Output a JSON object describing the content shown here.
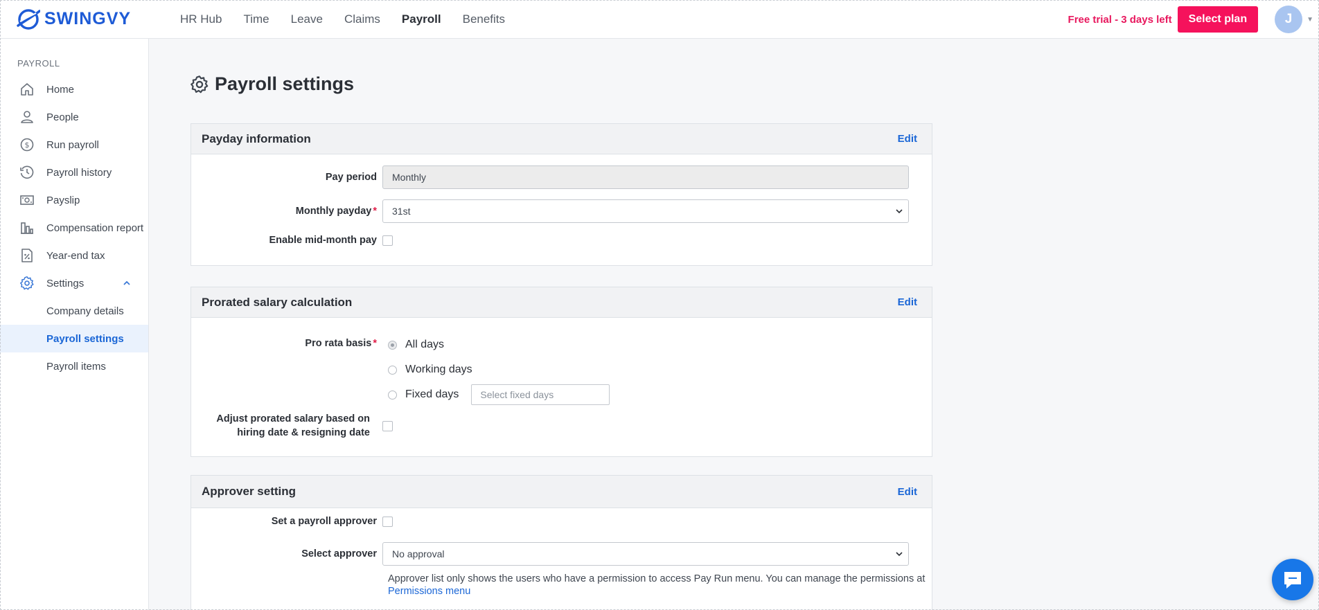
{
  "app": {
    "logo_text": "SWINGVY"
  },
  "nav": [
    {
      "label": "HR Hub",
      "active": false
    },
    {
      "label": "Time",
      "active": false
    },
    {
      "label": "Leave",
      "active": false
    },
    {
      "label": "Claims",
      "active": false
    },
    {
      "label": "Payroll",
      "active": true
    },
    {
      "label": "Benefits",
      "active": false
    }
  ],
  "header": {
    "trial_text": "Free trial - 3 days left",
    "plan_button": "Select plan",
    "avatar_initial": "J"
  },
  "sidebar": {
    "section": "PAYROLL",
    "items": [
      {
        "label": "Home",
        "icon": "home-icon"
      },
      {
        "label": "People",
        "icon": "person-icon"
      },
      {
        "label": "Run payroll",
        "icon": "dollar-circle-icon"
      },
      {
        "label": "Payroll history",
        "icon": "history-icon"
      },
      {
        "label": "Payslip",
        "icon": "money-bill-icon"
      },
      {
        "label": "Compensation report",
        "icon": "bar-chart-icon"
      },
      {
        "label": "Year-end tax",
        "icon": "percent-doc-icon"
      },
      {
        "label": "Settings",
        "icon": "gear-icon"
      }
    ],
    "sub_items": [
      {
        "label": "Company details",
        "active": false
      },
      {
        "label": "Payroll settings",
        "active": true
      },
      {
        "label": "Payroll items",
        "active": false
      }
    ]
  },
  "page": {
    "title": "Payroll settings"
  },
  "payday": {
    "title": "Payday information",
    "edit": "Edit",
    "pay_period_label": "Pay period",
    "pay_period_value": "Monthly",
    "monthly_payday_label": "Monthly payday",
    "monthly_payday_value": "31st",
    "mid_month_label": "Enable mid-month pay"
  },
  "prorated": {
    "title": "Prorated salary calculation",
    "edit": "Edit",
    "basis_label": "Pro rata basis",
    "options": [
      {
        "label": "All days",
        "checked": true
      },
      {
        "label": "Working days",
        "checked": false
      },
      {
        "label": "Fixed days",
        "checked": false
      }
    ],
    "fixed_days_placeholder": "Select fixed days",
    "adjust_label_line1": "Adjust prorated salary based on",
    "adjust_label_line2": "hiring date & resigning date"
  },
  "approver": {
    "title": "Approver setting",
    "edit": "Edit",
    "set_approver_label": "Set a payroll approver",
    "select_label": "Select approver",
    "select_value": "No approval",
    "note": "Approver list only shows the users who have a permission to access Pay Run menu. You can manage the permissions at",
    "note_link": "Permissions menu"
  },
  "colors": {
    "brand": "#1e5bd6",
    "accent": "#f5125c",
    "link": "#1a66d6",
    "required": "#e11d48"
  }
}
